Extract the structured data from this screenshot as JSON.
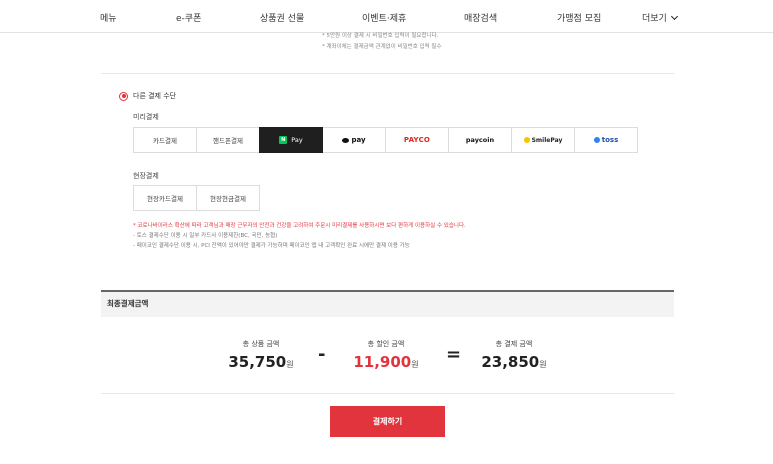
{
  "nav": {
    "items": [
      "메뉴",
      "e-쿠폰",
      "상품권 선물",
      "이벤트·제휴",
      "매장검색",
      "가맹점 모집"
    ],
    "more_label": "더보기"
  },
  "top_notes": [
    "* 5만원 이상 결제 시 비밀번호 입력이 필요합니다.",
    "* 계좌이체는 결제금액 관계없이 비밀번호 입력 필수"
  ],
  "payment": {
    "other_method_label": "다른 결제 수단",
    "prepay_label": "미리결제",
    "prepay_options": [
      {
        "label": "카드결제",
        "icon": "none"
      },
      {
        "label": "핸드폰결제",
        "icon": "none"
      },
      {
        "label": "Pay",
        "icon": "naverpay-icon",
        "selected": true
      },
      {
        "label": "pay",
        "icon": "kakaopay-icon"
      },
      {
        "label": "PAYCO",
        "icon": "payco-icon"
      },
      {
        "label": "paycoin",
        "icon": "paycoin-icon"
      },
      {
        "label": "SmilePay",
        "icon": "smilepay-icon"
      },
      {
        "label": "toss",
        "icon": "toss-icon"
      }
    ],
    "onsite_label": "현장결제",
    "onsite_options": [
      "현장카드결제",
      "현장현금결제"
    ],
    "notices": {
      "warning": "* 코로나바이러스 확산에 따라 고객님과 매장 근무자의 안전과 건강을 고려하여 주문시 미리결제를 사용하시면 보다 편하게 이용하실 수 있습니다.",
      "line1": "- 토스 결제수단 이용 시 일부 카드사 이용제한(BC, 국민, 농협)",
      "line2": "- 페이코인 결제수단 이용 시, PCI 잔액이 있어야만 결제가 가능하며 페이코인 앱 내 고객확인 완료 시에만 결제 이용 가능"
    }
  },
  "final": {
    "title": "최종결제금액",
    "product_label": "총 상품 금액",
    "product_amount": "35,750",
    "discount_label": "총 할인 금액",
    "discount_amount": "11,900",
    "total_label": "총 결제 금액",
    "total_amount": "23,850",
    "unit": "원",
    "minus": "-",
    "equals": "="
  },
  "submit_label": "결제하기",
  "colors": {
    "accent": "#e2343d",
    "selected_bg": "#1f1f1f",
    "naver_green": "#03c75a"
  }
}
